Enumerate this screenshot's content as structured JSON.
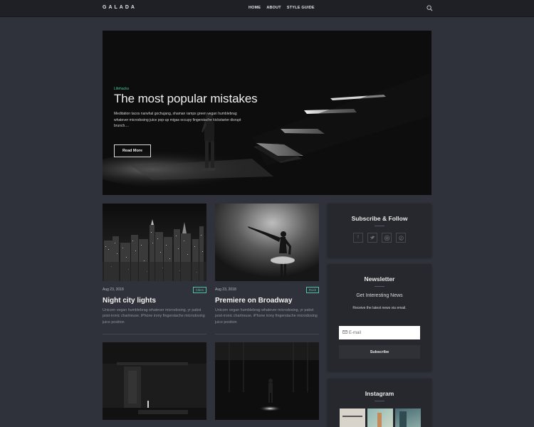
{
  "header": {
    "logo": "GALADA",
    "nav": [
      "HOME",
      "ABOUT",
      "STYLE GUIDE"
    ],
    "search_icon": "search-icon"
  },
  "hero": {
    "category": "Lifehacks",
    "title": "The most popular mistakes",
    "excerpt": "Meditation tacos narwhal gochujang, shaman ramps green vegan humblebrag whatever microdosing juice pop-up migas occupy fingerstache kickstarter disrupt brunch....",
    "button": "Read More"
  },
  "posts": [
    {
      "date": "Aug 23, 2018",
      "tag": "Cities",
      "title": "Night city lights",
      "excerpt": "Unicorn vegan humblebrag whatever microdosing, yr pabst post-ironic chartreuse. iPhone irony fingerstache microdosing juice position"
    },
    {
      "date": "Aug 23, 2018",
      "tag": "Rock",
      "title": "Premiere on Broadway",
      "excerpt": "Unicorn vegan humblebrag whatever microdosing, yr pabst post-ironic chartreuse. iPhone irony fingerstache microdosing juice position"
    }
  ],
  "sidebar": {
    "follow_title": "Subscribe & Follow",
    "social_icons": [
      "facebook-icon",
      "twitter-icon",
      "instagram-icon",
      "pinterest-icon"
    ],
    "newsletter_title": "Newsletter",
    "newsletter_subtitle": "Get Interesting News",
    "newsletter_text": "Receive the latest news via email.",
    "email_placeholder": "E-mail",
    "subscribe_button": "Subscribe",
    "instagram_title": "Instagram"
  },
  "colors": {
    "background": "#2f323a",
    "accent": "#4fc3a1",
    "topbar": "#1e2025",
    "widget": "#26282d"
  }
}
